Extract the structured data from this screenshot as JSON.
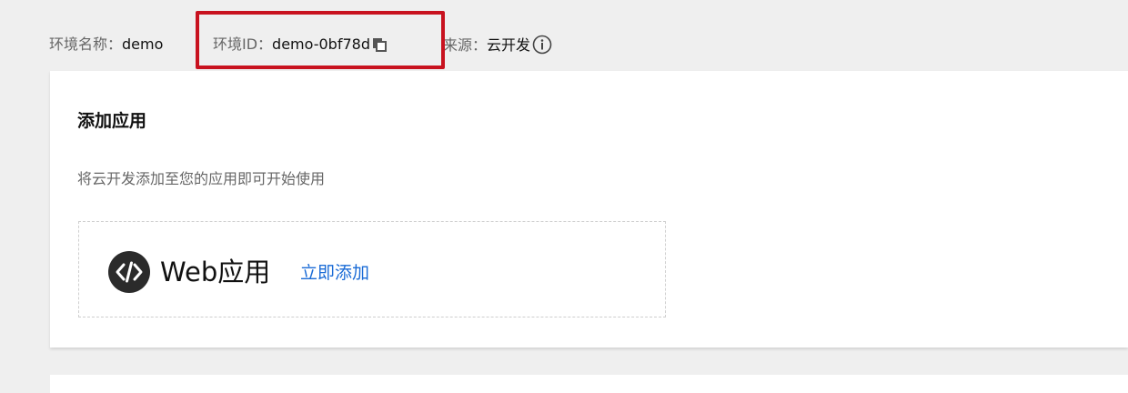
{
  "env": {
    "name_label": "环境名称：",
    "name_value": "demo",
    "id_label": "环境ID：",
    "id_value": "demo-0bf78d",
    "source_label": "来源：",
    "source_value": "云开发"
  },
  "icons": {
    "copy": "copy-icon",
    "info": "info-icon",
    "web_app": "code-icon"
  },
  "colors": {
    "highlight": "#c8121f",
    "link": "#1a6bd6"
  },
  "card": {
    "title": "添加应用",
    "description": "将云开发添加至您的应用即可开始使用",
    "app": {
      "name": "Web应用",
      "action_label": "立即添加"
    }
  }
}
